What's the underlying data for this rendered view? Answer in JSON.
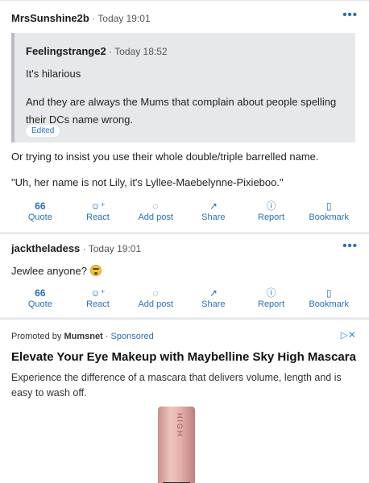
{
  "posts": [
    {
      "username": "MrsSunshine2b",
      "time": "Today 19:01",
      "quote": {
        "username": "Feelingstrange2",
        "time": "Today 18:52",
        "line1": "It's hilarious",
        "line2": "And they are always the Mums that complain about people spelling their DCs name wrong.",
        "edited": "Edited"
      },
      "body1": "Or trying to insist you use their whole double/triple barrelled name.",
      "body2": "\"Uh, her name is not Lily, it's Lyllee-Maebelynne-Pixieboo.\""
    },
    {
      "username": "jacktheladess",
      "time": "Today 19:01",
      "body1": "Jewlee anyone?"
    }
  ],
  "actions": {
    "quote": "Quote",
    "react": "React",
    "add_post": "Add post",
    "share": "Share",
    "report": "Report",
    "bookmark": "Bookmark"
  },
  "icons": {
    "more": "more-dots-icon",
    "quote": "quote-icon",
    "react": "react-emoji-icon",
    "add_post": "speech-bubble-icon",
    "share": "share-arrow-icon",
    "report": "info-circle-icon",
    "bookmark": "bookmark-icon",
    "ad_choices": "ad-choices-icon"
  },
  "ad": {
    "promoted_by": "Promoted by",
    "advertiser": "Mumsnet",
    "sponsored": "Sponsored",
    "title": "Elevate Your Eye Makeup with Maybelline Sky High Mascara",
    "description": "Experience the difference of a mascara that delivers volume, length and is easy to wash off.",
    "product_brand": "HIGH"
  },
  "colors": {
    "accent": "#2a6fb5",
    "quote_bg": "#e6e8ec",
    "page_bg": "#e9ebee"
  }
}
